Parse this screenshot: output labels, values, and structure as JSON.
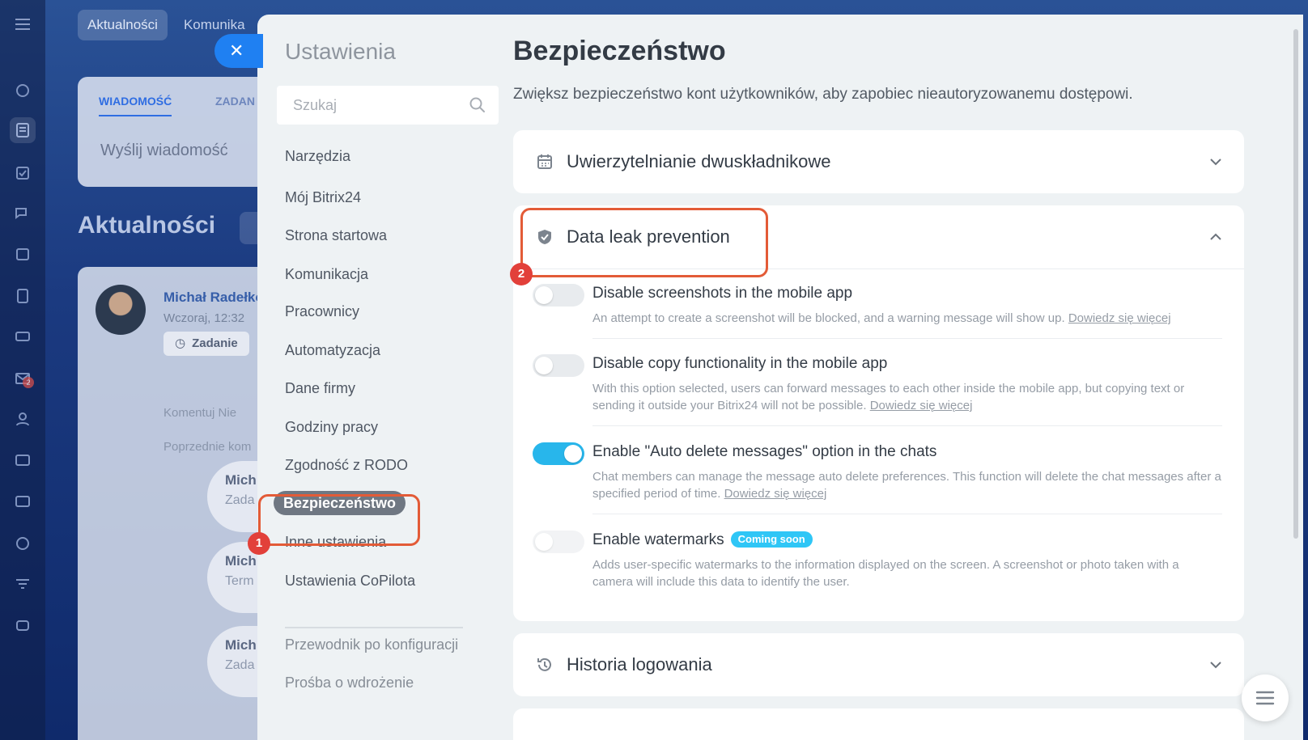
{
  "background": {
    "top_tabs": [
      "Aktualności",
      "Komunika"
    ],
    "compose": {
      "tabs": [
        "WIADOMOŚĆ",
        "ZADAN"
      ],
      "placeholder": "Wyślij wiadomość"
    },
    "feed_title": "Aktualności",
    "post": {
      "author": "Michał Radełko",
      "time": "Wczoraj, 12:32",
      "tag": "Zadanie",
      "actions": "Komentuj   Nie",
      "previous": "Poprzednie kom",
      "comments": [
        {
          "name": "Mich",
          "sub": "Zada"
        },
        {
          "name": "Mich",
          "sub": "Term"
        },
        {
          "name": "Mich",
          "sub": "Zada"
        }
      ]
    },
    "rail_badge": "2"
  },
  "settings": {
    "title": "Ustawienia",
    "search_placeholder": "Szukaj",
    "nav": [
      {
        "label": "Narzędzia"
      },
      {
        "label": "Mój Bitrix24"
      },
      {
        "label": "Strona startowa"
      },
      {
        "label": "Komunikacja"
      },
      {
        "label": "Pracownicy"
      },
      {
        "label": "Automatyzacja"
      },
      {
        "label": "Dane firmy"
      },
      {
        "label": "Godziny pracy"
      },
      {
        "label": "Zgodność z RODO"
      },
      {
        "label": "Bezpieczeństwo",
        "active": true
      },
      {
        "label": "Inne ustawienia"
      },
      {
        "label": "Ustawienia CoPilota"
      }
    ],
    "nav_secondary": [
      {
        "label": "Przewodnik po konfiguracji"
      },
      {
        "label": "Prośba o wdrożenie"
      }
    ]
  },
  "page": {
    "title": "Bezpieczeństwo",
    "description": "Zwiększ bezpieczeństwo kont użytkowników, aby zapobiec nieautoryzowanemu dostępowi.",
    "sections": [
      {
        "title": "Uwierzytelnianie dwuskładnikowe",
        "icon": "calendar-icon",
        "expanded": false
      },
      {
        "title": "Data leak prevention",
        "icon": "shield-icon",
        "expanded": true,
        "options": [
          {
            "title": "Disable screenshots in the mobile app",
            "desc": "An attempt to create a screenshot will be blocked, and a warning message will show up.",
            "link": "Dowiedz się więcej",
            "enabled": false
          },
          {
            "title": "Disable copy functionality in the mobile app",
            "desc": "With this option selected, users can forward messages to each other inside the mobile app, but copying text or sending it outside your Bitrix24 will not be possible.",
            "link": "Dowiedz się więcej",
            "enabled": false
          },
          {
            "title": "Enable \"Auto delete messages\" option in the chats",
            "desc": "Chat members can manage the message auto delete preferences. This function will delete the chat messages after a specified period of time.",
            "link": "Dowiedz się więcej",
            "enabled": true
          },
          {
            "title": "Enable watermarks",
            "badge": "Coming soon",
            "desc": "Adds user-specific watermarks to the information displayed on the screen. A screenshot or photo taken with a camera will include this data to identify the user.",
            "enabled": false,
            "disabled": true
          }
        ]
      },
      {
        "title": "Historia logowania",
        "icon": "history-icon",
        "expanded": false
      }
    ]
  },
  "callouts": [
    "1",
    "2"
  ],
  "colors": {
    "accent": "#28b6eb",
    "highlight": "#e35b37",
    "badge": "#2fc6f6",
    "close": "#1f80f2"
  }
}
